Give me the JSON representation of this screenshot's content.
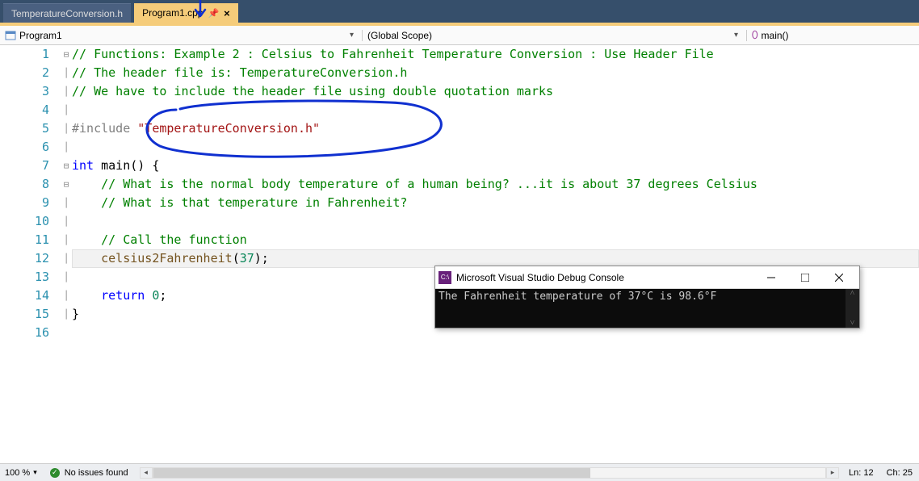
{
  "tabs": {
    "inactive": "TemperatureConversion.h",
    "active": "Program1.cpp"
  },
  "nav": {
    "scope1_label": "Program1",
    "scope2_label": "(Global Scope)",
    "scope3_label": "main()"
  },
  "code": {
    "l1": "// Functions: Example 2 : Celsius to Fahrenheit Temperature Conversion : Use Header File",
    "l2": "// The header file is: TemperatureConversion.h",
    "l3": "// We have to include the header file using double quotation marks",
    "l5_pre": "#include ",
    "l5_str": "\"TemperatureConversion.h\"",
    "l7_kw1": "int",
    "l7_fn": " main",
    "l7_rest": "() {",
    "l8": "    // What is the normal body temperature of a human being? ...it is about 37 degrees Celsius",
    "l9": "    // What is that temperature in Fahrenheit?",
    "l11": "    // Call the function",
    "l12_indent": "    ",
    "l12_fn": "celsius2Fahrenheit",
    "l12_paren": "(",
    "l12_num": "37",
    "l12_rest": ");",
    "l14_indent": "    ",
    "l14_kw": "return",
    "l14_sp": " ",
    "l14_num": "0",
    "l14_rest": ";",
    "l15": "}",
    "linenums": [
      "1",
      "2",
      "3",
      "4",
      "5",
      "6",
      "7",
      "8",
      "9",
      "10",
      "11",
      "12",
      "13",
      "14",
      "15",
      "16"
    ]
  },
  "console": {
    "title": "Microsoft Visual Studio Debug Console",
    "output": "The Fahrenheit temperature of 37°C is 98.6°F"
  },
  "status": {
    "zoom": "100 %",
    "issues": "No issues found",
    "ln": "Ln: 12",
    "ch": "Ch: 25"
  }
}
